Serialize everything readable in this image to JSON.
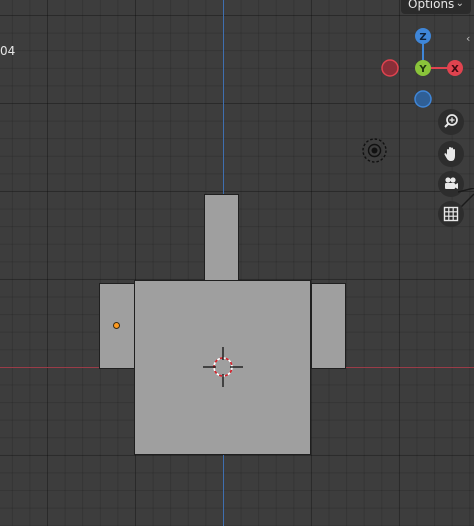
{
  "header": {
    "options_label": "Options",
    "frame_counter": "04"
  },
  "gizmo": {
    "z_label": "Z",
    "y_label": "Y",
    "x_label": "X"
  },
  "nav_buttons": [
    {
      "icon": "zoom-icon"
    },
    {
      "icon": "hand-pan-icon"
    },
    {
      "icon": "camera-icon"
    },
    {
      "icon": "grid-icon"
    }
  ],
  "colors": {
    "viewport_bg": "#3d3d3d",
    "axis_x": "#9a3c48",
    "axis_y": "#3f6fb0",
    "gizmo_x": "#e0434f",
    "gizmo_y": "#8ac43a",
    "gizmo_z": "#3f86d8",
    "object_fill": "#9f9f9f",
    "origin_dot": "#ff9a1e"
  }
}
